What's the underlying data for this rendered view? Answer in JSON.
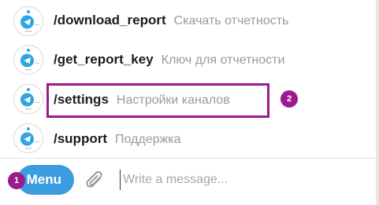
{
  "commands": [
    {
      "name": "/download_report",
      "description": "Скачать отчетность"
    },
    {
      "name": "/get_report_key",
      "description": "Ключ для отчетности"
    },
    {
      "name": "/settings",
      "description": "Настройки каналов"
    },
    {
      "name": "/support",
      "description": "Поддержка"
    }
  ],
  "input_bar": {
    "menu_label": "Menu",
    "placeholder": "Write a message..."
  },
  "annotations": {
    "step_1": "1",
    "step_2": "2",
    "accent_color": "#9b1b8e"
  },
  "colors": {
    "menu_button": "#3a9de0",
    "bot_avatar_icon": "#2ca5e0"
  },
  "icons": {
    "bot_avatar": "telegram-bot-icon",
    "attach": "paperclip-icon"
  }
}
